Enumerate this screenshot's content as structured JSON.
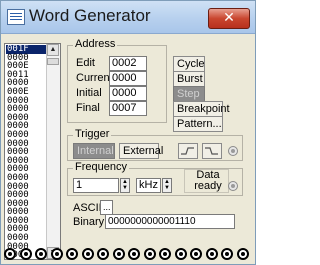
{
  "window": {
    "title": "Word Generator",
    "close_glyph": "✕"
  },
  "list": {
    "rows": [
      "001F",
      "0000",
      "000E",
      "0011",
      "0000",
      "000E",
      "0000",
      "0000",
      "0000",
      "0000",
      "0000",
      "0000",
      "0000",
      "0000",
      "0000",
      "0000",
      "0000",
      "0000",
      "0000",
      "0000",
      "0000",
      "0000",
      "0000",
      "0000",
      "0000"
    ],
    "selected_index": 0,
    "scroll_up": "▲",
    "scroll_down": "▼"
  },
  "address": {
    "label": "Address",
    "edit_label": "Edit",
    "edit_value": "0002",
    "current_label": "Current",
    "current_value": "0000",
    "initial_label": "Initial",
    "initial_value": "0000",
    "final_label": "Final",
    "final_value": "0007"
  },
  "buttons": {
    "cycle": "Cycle",
    "burst": "Burst",
    "step": "Step",
    "breakpoint": "Breakpoint",
    "pattern": "Pattern..."
  },
  "trigger": {
    "label": "Trigger",
    "internal": "Internal",
    "external": "External",
    "rising_icon": "rising-edge-icon",
    "falling_icon": "falling-edge-icon"
  },
  "frequency": {
    "label": "Frequency",
    "value": "1",
    "unit": "kHz",
    "data_ready": "Data ready"
  },
  "ascii": {
    "label": "ASCII",
    "value": "..."
  },
  "binary": {
    "label": "Binary",
    "value": "0000000000001110"
  },
  "terminals": {
    "count": 16
  },
  "colors": {
    "selection": "#0a246a",
    "close": "#c9462f",
    "window_bg": "#ece9d8"
  }
}
